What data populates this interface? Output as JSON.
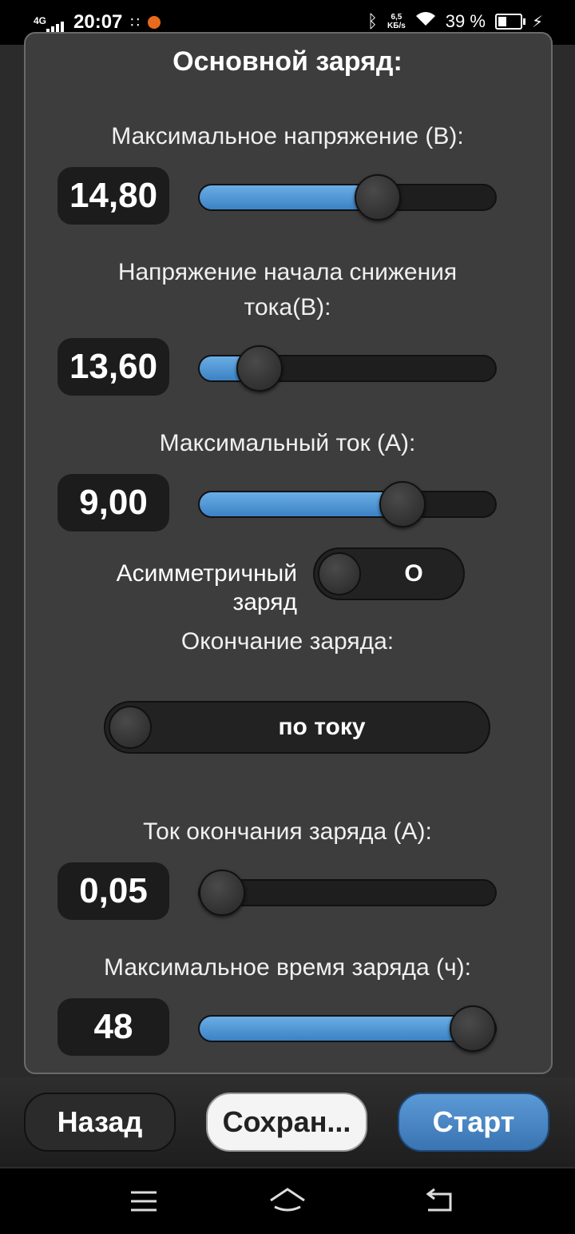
{
  "status_bar": {
    "network": "4G",
    "time": "20:07",
    "speed_value": "6,5",
    "speed_unit": "KБ/s",
    "battery": "39 %",
    "icons": [
      "signal-icon",
      "cast-icon",
      "app-notification-icon",
      "bluetooth-icon",
      "wifi-icon",
      "battery-icon",
      "charging-icon"
    ]
  },
  "section_title": "Основной заряд:",
  "max_voltage": {
    "label": "Максимальное напряжение (В):",
    "value": "14,80",
    "level": 0.62
  },
  "decline_voltage": {
    "label_line1": "Напряжение начала снижения",
    "label_line2": "тока(В):",
    "value": "13,60",
    "level": 0.15
  },
  "max_current": {
    "label": "Максимальный ток (А):",
    "value": "9,00",
    "level": 0.72
  },
  "asymmetric": {
    "label_line1": "Асимметричный",
    "label_line2": "заряд",
    "state_text": "О"
  },
  "charge_end": {
    "label": "Окончание заряда:",
    "mode": "по току"
  },
  "end_current": {
    "label": "Ток окончания заряда (А):",
    "value": "0,05",
    "level": 0.0
  },
  "max_time": {
    "label": "Максимальное время заряда (ч):",
    "value": "48",
    "level": 1.0
  },
  "buttons": {
    "back": "Назад",
    "save": "Сохран...",
    "start": "Старт"
  },
  "colors": {
    "accent": "#4a90d0",
    "panel": "#3d3d3d",
    "background": "#2b2b2b"
  }
}
